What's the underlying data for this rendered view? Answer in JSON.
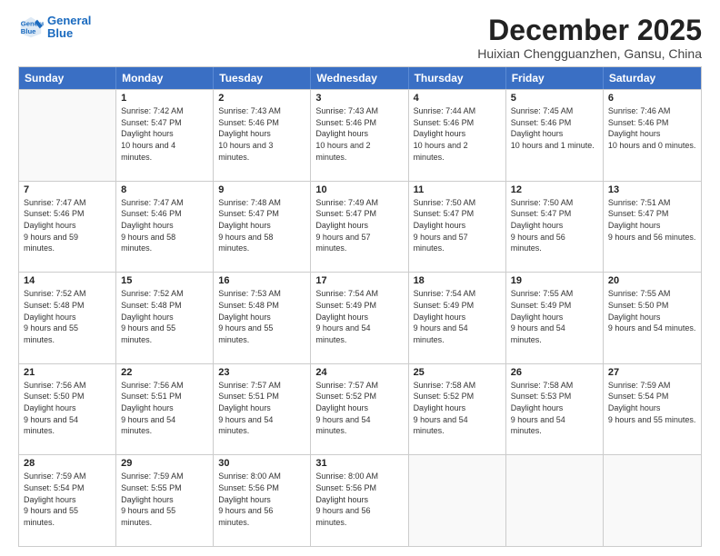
{
  "logo": {
    "line1": "General",
    "line2": "Blue"
  },
  "title": "December 2025",
  "location": "Huixian Chengguanzhen, Gansu, China",
  "days_of_week": [
    "Sunday",
    "Monday",
    "Tuesday",
    "Wednesday",
    "Thursday",
    "Friday",
    "Saturday"
  ],
  "weeks": [
    [
      {
        "day": "",
        "empty": true
      },
      {
        "day": "1",
        "sunrise": "7:42 AM",
        "sunset": "5:47 PM",
        "daylight": "10 hours and 4 minutes."
      },
      {
        "day": "2",
        "sunrise": "7:43 AM",
        "sunset": "5:46 PM",
        "daylight": "10 hours and 3 minutes."
      },
      {
        "day": "3",
        "sunrise": "7:43 AM",
        "sunset": "5:46 PM",
        "daylight": "10 hours and 2 minutes."
      },
      {
        "day": "4",
        "sunrise": "7:44 AM",
        "sunset": "5:46 PM",
        "daylight": "10 hours and 2 minutes."
      },
      {
        "day": "5",
        "sunrise": "7:45 AM",
        "sunset": "5:46 PM",
        "daylight": "10 hours and 1 minute."
      },
      {
        "day": "6",
        "sunrise": "7:46 AM",
        "sunset": "5:46 PM",
        "daylight": "10 hours and 0 minutes."
      }
    ],
    [
      {
        "day": "7",
        "sunrise": "7:47 AM",
        "sunset": "5:46 PM",
        "daylight": "9 hours and 59 minutes."
      },
      {
        "day": "8",
        "sunrise": "7:47 AM",
        "sunset": "5:46 PM",
        "daylight": "9 hours and 58 minutes."
      },
      {
        "day": "9",
        "sunrise": "7:48 AM",
        "sunset": "5:47 PM",
        "daylight": "9 hours and 58 minutes."
      },
      {
        "day": "10",
        "sunrise": "7:49 AM",
        "sunset": "5:47 PM",
        "daylight": "9 hours and 57 minutes."
      },
      {
        "day": "11",
        "sunrise": "7:50 AM",
        "sunset": "5:47 PM",
        "daylight": "9 hours and 57 minutes."
      },
      {
        "day": "12",
        "sunrise": "7:50 AM",
        "sunset": "5:47 PM",
        "daylight": "9 hours and 56 minutes."
      },
      {
        "day": "13",
        "sunrise": "7:51 AM",
        "sunset": "5:47 PM",
        "daylight": "9 hours and 56 minutes."
      }
    ],
    [
      {
        "day": "14",
        "sunrise": "7:52 AM",
        "sunset": "5:48 PM",
        "daylight": "9 hours and 55 minutes."
      },
      {
        "day": "15",
        "sunrise": "7:52 AM",
        "sunset": "5:48 PM",
        "daylight": "9 hours and 55 minutes."
      },
      {
        "day": "16",
        "sunrise": "7:53 AM",
        "sunset": "5:48 PM",
        "daylight": "9 hours and 55 minutes."
      },
      {
        "day": "17",
        "sunrise": "7:54 AM",
        "sunset": "5:49 PM",
        "daylight": "9 hours and 54 minutes."
      },
      {
        "day": "18",
        "sunrise": "7:54 AM",
        "sunset": "5:49 PM",
        "daylight": "9 hours and 54 minutes."
      },
      {
        "day": "19",
        "sunrise": "7:55 AM",
        "sunset": "5:49 PM",
        "daylight": "9 hours and 54 minutes."
      },
      {
        "day": "20",
        "sunrise": "7:55 AM",
        "sunset": "5:50 PM",
        "daylight": "9 hours and 54 minutes."
      }
    ],
    [
      {
        "day": "21",
        "sunrise": "7:56 AM",
        "sunset": "5:50 PM",
        "daylight": "9 hours and 54 minutes."
      },
      {
        "day": "22",
        "sunrise": "7:56 AM",
        "sunset": "5:51 PM",
        "daylight": "9 hours and 54 minutes."
      },
      {
        "day": "23",
        "sunrise": "7:57 AM",
        "sunset": "5:51 PM",
        "daylight": "9 hours and 54 minutes."
      },
      {
        "day": "24",
        "sunrise": "7:57 AM",
        "sunset": "5:52 PM",
        "daylight": "9 hours and 54 minutes."
      },
      {
        "day": "25",
        "sunrise": "7:58 AM",
        "sunset": "5:52 PM",
        "daylight": "9 hours and 54 minutes."
      },
      {
        "day": "26",
        "sunrise": "7:58 AM",
        "sunset": "5:53 PM",
        "daylight": "9 hours and 54 minutes."
      },
      {
        "day": "27",
        "sunrise": "7:59 AM",
        "sunset": "5:54 PM",
        "daylight": "9 hours and 55 minutes."
      }
    ],
    [
      {
        "day": "28",
        "sunrise": "7:59 AM",
        "sunset": "5:54 PM",
        "daylight": "9 hours and 55 minutes."
      },
      {
        "day": "29",
        "sunrise": "7:59 AM",
        "sunset": "5:55 PM",
        "daylight": "9 hours and 55 minutes."
      },
      {
        "day": "30",
        "sunrise": "8:00 AM",
        "sunset": "5:56 PM",
        "daylight": "9 hours and 56 minutes."
      },
      {
        "day": "31",
        "sunrise": "8:00 AM",
        "sunset": "5:56 PM",
        "daylight": "9 hours and 56 minutes."
      },
      {
        "day": "",
        "empty": true
      },
      {
        "day": "",
        "empty": true
      },
      {
        "day": "",
        "empty": true
      }
    ]
  ]
}
